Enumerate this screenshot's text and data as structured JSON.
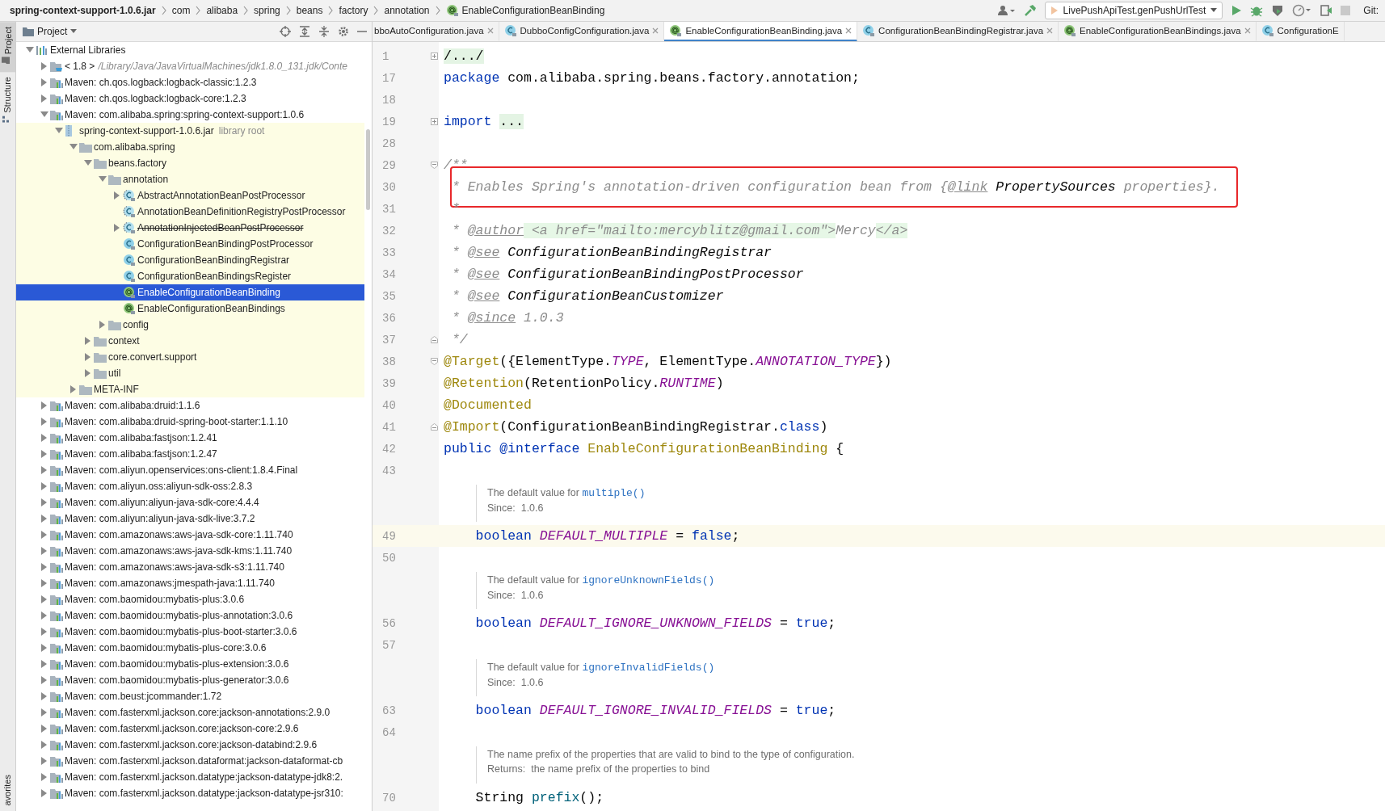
{
  "breadcrumbs": [
    {
      "label": "spring-context-support-1.0.6.jar",
      "kind": "jar"
    },
    {
      "label": "com",
      "kind": "package"
    },
    {
      "label": "alibaba",
      "kind": "package"
    },
    {
      "label": "spring",
      "kind": "package"
    },
    {
      "label": "beans",
      "kind": "package"
    },
    {
      "label": "factory",
      "kind": "package"
    },
    {
      "label": "annotation",
      "kind": "package"
    },
    {
      "label": "EnableConfigurationBeanBinding",
      "kind": "annotation"
    }
  ],
  "toolbar": {
    "run_config": "LivePushApiTest.genPushUrlTest",
    "vcs_label": "Git:"
  },
  "side_tabs": [
    {
      "label": "Project",
      "at_bottom": false,
      "selected": true
    },
    {
      "label": "Structure",
      "at_bottom": false,
      "selected": false
    },
    {
      "label": "avorites",
      "at_bottom": true,
      "selected": false
    }
  ],
  "project_panel": {
    "title": "Project",
    "tree": [
      {
        "label": "External Libraries",
        "kind": "libraries",
        "expanded": true,
        "selected": false,
        "children": [
          {
            "label": "< 1.8 >",
            "detail": "/Library/Java/JavaVirtualMachines/jdk1.8.0_131.jdk/Conte",
            "kind": "jdk",
            "expanded": false,
            "selected": false
          },
          {
            "label": "Maven: ch.qos.logback:logback-classic:1.2.3",
            "kind": "library",
            "expanded": false,
            "selected": false
          },
          {
            "label": "Maven: ch.qos.logback:logback-core:1.2.3",
            "kind": "library",
            "expanded": false,
            "selected": false
          },
          {
            "label": "Maven: com.alibaba.spring:spring-context-support:1.0.6",
            "kind": "library",
            "expanded": true,
            "selected": false,
            "children": [
              {
                "label": "spring-context-support-1.0.6.jar",
                "detail": "library root",
                "kind": "jar",
                "scope": true,
                "expanded": true,
                "selected": false,
                "children": [
                  {
                    "label": "com.alibaba.spring",
                    "kind": "folder",
                    "expanded": true,
                    "selected": false,
                    "children": [
                      {
                        "label": "beans.factory",
                        "kind": "folder",
                        "expanded": true,
                        "selected": false,
                        "children": [
                          {
                            "label": "annotation",
                            "kind": "folder",
                            "expanded": true,
                            "selected": false,
                            "children": [
                              {
                                "label": "AbstractAnnotationBeanPostProcessor",
                                "kind": "abstract-class",
                                "expanded": false,
                                "deprecated": false,
                                "selected": false
                              },
                              {
                                "label": "AnnotationBeanDefinitionRegistryPostProcessor",
                                "kind": "abstract-class",
                                "deprecated": false,
                                "selected": false
                              },
                              {
                                "label": "AnnotationInjectedBeanPostProcessor",
                                "kind": "abstract-class",
                                "expanded": false,
                                "deprecated": true,
                                "selected": false
                              },
                              {
                                "label": "ConfigurationBeanBindingPostProcessor",
                                "kind": "class",
                                "deprecated": false,
                                "selected": false
                              },
                              {
                                "label": "ConfigurationBeanBindingRegistrar",
                                "kind": "class",
                                "deprecated": false,
                                "selected": false
                              },
                              {
                                "label": "ConfigurationBeanBindingsRegister",
                                "kind": "class",
                                "deprecated": false,
                                "selected": false
                              },
                              {
                                "label": "EnableConfigurationBeanBinding",
                                "kind": "annotation",
                                "deprecated": false,
                                "selected": true
                              },
                              {
                                "label": "EnableConfigurationBeanBindings",
                                "kind": "annotation",
                                "deprecated": false,
                                "selected": false
                              }
                            ]
                          },
                          {
                            "label": "config",
                            "kind": "folder",
                            "expanded": false,
                            "selected": false
                          }
                        ]
                      },
                      {
                        "label": "context",
                        "kind": "folder",
                        "expanded": false,
                        "selected": false
                      },
                      {
                        "label": "core.convert.support",
                        "kind": "folder",
                        "expanded": false,
                        "selected": false
                      },
                      {
                        "label": "util",
                        "kind": "folder",
                        "expanded": false,
                        "selected": false
                      }
                    ]
                  },
                  {
                    "label": "META-INF",
                    "kind": "folder",
                    "expanded": false,
                    "selected": false
                  }
                ]
              }
            ]
          },
          {
            "label": "Maven: com.alibaba:druid:1.1.6",
            "kind": "library",
            "expanded": false,
            "selected": false
          },
          {
            "label": "Maven: com.alibaba:druid-spring-boot-starter:1.1.10",
            "kind": "library",
            "expanded": false,
            "selected": false
          },
          {
            "label": "Maven: com.alibaba:fastjson:1.2.41",
            "kind": "library",
            "expanded": false,
            "selected": false
          },
          {
            "label": "Maven: com.alibaba:fastjson:1.2.47",
            "kind": "library",
            "expanded": false,
            "selected": false
          },
          {
            "label": "Maven: com.aliyun.openservices:ons-client:1.8.4.Final",
            "kind": "library",
            "expanded": false,
            "selected": false
          },
          {
            "label": "Maven: com.aliyun.oss:aliyun-sdk-oss:2.8.3",
            "kind": "library",
            "expanded": false,
            "selected": false
          },
          {
            "label": "Maven: com.aliyun:aliyun-java-sdk-core:4.4.4",
            "kind": "library",
            "expanded": false,
            "selected": false
          },
          {
            "label": "Maven: com.aliyun:aliyun-java-sdk-live:3.7.2",
            "kind": "library",
            "expanded": false,
            "selected": false
          },
          {
            "label": "Maven: com.amazonaws:aws-java-sdk-core:1.11.740",
            "kind": "library",
            "expanded": false,
            "selected": false
          },
          {
            "label": "Maven: com.amazonaws:aws-java-sdk-kms:1.11.740",
            "kind": "library",
            "expanded": false,
            "selected": false
          },
          {
            "label": "Maven: com.amazonaws:aws-java-sdk-s3:1.11.740",
            "kind": "library",
            "expanded": false,
            "selected": false
          },
          {
            "label": "Maven: com.amazonaws:jmespath-java:1.11.740",
            "kind": "library",
            "expanded": false,
            "selected": false
          },
          {
            "label": "Maven: com.baomidou:mybatis-plus:3.0.6",
            "kind": "library",
            "expanded": false,
            "selected": false
          },
          {
            "label": "Maven: com.baomidou:mybatis-plus-annotation:3.0.6",
            "kind": "library",
            "expanded": false,
            "selected": false
          },
          {
            "label": "Maven: com.baomidou:mybatis-plus-boot-starter:3.0.6",
            "kind": "library",
            "expanded": false,
            "selected": false
          },
          {
            "label": "Maven: com.baomidou:mybatis-plus-core:3.0.6",
            "kind": "library",
            "expanded": false,
            "selected": false
          },
          {
            "label": "Maven: com.baomidou:mybatis-plus-extension:3.0.6",
            "kind": "library",
            "expanded": false,
            "selected": false
          },
          {
            "label": "Maven: com.baomidou:mybatis-plus-generator:3.0.6",
            "kind": "library",
            "expanded": false,
            "selected": false
          },
          {
            "label": "Maven: com.beust:jcommander:1.72",
            "kind": "library",
            "expanded": false,
            "selected": false
          },
          {
            "label": "Maven: com.fasterxml.jackson.core:jackson-annotations:2.9.0",
            "kind": "library",
            "expanded": false,
            "selected": false
          },
          {
            "label": "Maven: com.fasterxml.jackson.core:jackson-core:2.9.6",
            "kind": "library",
            "expanded": false,
            "selected": false
          },
          {
            "label": "Maven: com.fasterxml.jackson.core:jackson-databind:2.9.6",
            "kind": "library",
            "expanded": false,
            "selected": false
          },
          {
            "label": "Maven: com.fasterxml.jackson.dataformat:jackson-dataformat-cb",
            "kind": "library",
            "expanded": false,
            "selected": false
          },
          {
            "label": "Maven: com.fasterxml.jackson.datatype:jackson-datatype-jdk8:2.",
            "kind": "library",
            "expanded": false,
            "selected": false
          },
          {
            "label": "Maven: com.fasterxml.jackson.datatype:jackson-datatype-jsr310:",
            "kind": "library",
            "expanded": false,
            "selected": false
          }
        ]
      }
    ]
  },
  "editor": {
    "tabs": [
      {
        "label": "bboAutoConfiguration.java",
        "kind": "none",
        "closable": true,
        "selected": false
      },
      {
        "label": "DubboConfigConfiguration.java",
        "kind": "class",
        "closable": true,
        "selected": false
      },
      {
        "label": "EnableConfigurationBeanBinding.java",
        "kind": "annotation",
        "closable": true,
        "selected": true
      },
      {
        "label": "ConfigurationBeanBindingRegistrar.java",
        "kind": "class",
        "closable": true,
        "selected": false
      },
      {
        "label": "EnableConfigurationBeanBindings.java",
        "kind": "annotation",
        "closable": true,
        "selected": false
      },
      {
        "label": "ConfigurationE",
        "kind": "class",
        "closable": false,
        "selected": false
      }
    ],
    "lines": [
      {
        "kind": "code",
        "number": "1",
        "fold": {
          "kind": "collapsed"
        },
        "tokens": [
          {
            "text": "/.../",
            "kind": "folded"
          }
        ]
      },
      {
        "kind": "code",
        "number": "17",
        "tokens": [
          {
            "text": "package",
            "kind": "kw"
          },
          {
            "text": " com.alibaba.spring.beans.factory.annotation;",
            "kind": "plain"
          }
        ]
      },
      {
        "kind": "code",
        "number": "18"
      },
      {
        "kind": "code",
        "number": "19",
        "fold": {
          "kind": "collapsed"
        },
        "tokens": [
          {
            "text": "import ",
            "kind": "kw"
          },
          {
            "text": "...",
            "kind": "folded"
          }
        ]
      },
      {
        "kind": "code",
        "number": "28"
      },
      {
        "kind": "code",
        "number": "29",
        "fold": {
          "kind": "start"
        },
        "tokens": [
          {
            "text": "/**",
            "kind": "comment"
          }
        ]
      },
      {
        "kind": "code",
        "number": "30",
        "boxed": true,
        "tokens": [
          {
            "text": " * Enables Spring's annotation-driven configuration bean from {",
            "kind": "comment"
          },
          {
            "text": "@link",
            "kind": "doctag"
          },
          {
            "text": " PropertySources",
            "kind": "docref"
          },
          {
            "text": " properties}.",
            "kind": "comment"
          }
        ]
      },
      {
        "kind": "code",
        "number": "31",
        "tokens": [
          {
            "text": " *",
            "kind": "comment"
          }
        ]
      },
      {
        "kind": "code",
        "number": "32",
        "tokens": [
          {
            "text": " * ",
            "kind": "comment"
          },
          {
            "text": "@author",
            "kind": "doctag"
          },
          {
            "text": " <a href=\"mailto:mercyblitz@gmail.com\">",
            "kind": "html"
          },
          {
            "text": "Mercy",
            "kind": "comment"
          },
          {
            "text": "</a>",
            "kind": "html"
          }
        ]
      },
      {
        "kind": "code",
        "number": "33",
        "tokens": [
          {
            "text": " * ",
            "kind": "comment"
          },
          {
            "text": "@see",
            "kind": "doctag"
          },
          {
            "text": " ConfigurationBeanBindingRegistrar",
            "kind": "docref"
          }
        ]
      },
      {
        "kind": "code",
        "number": "34",
        "tokens": [
          {
            "text": " * ",
            "kind": "comment"
          },
          {
            "text": "@see",
            "kind": "doctag"
          },
          {
            "text": " ConfigurationBeanBindingPostProcessor",
            "kind": "docref"
          }
        ]
      },
      {
        "kind": "code",
        "number": "35",
        "tokens": [
          {
            "text": " * ",
            "kind": "comment"
          },
          {
            "text": "@see",
            "kind": "doctag"
          },
          {
            "text": " ConfigurationBeanCustomizer",
            "kind": "docref"
          }
        ]
      },
      {
        "kind": "code",
        "number": "36",
        "tokens": [
          {
            "text": " * ",
            "kind": "comment"
          },
          {
            "text": "@since",
            "kind": "doctag"
          },
          {
            "text": " 1.0.3",
            "kind": "comment"
          }
        ]
      },
      {
        "kind": "code",
        "number": "37",
        "fold": {
          "kind": "end"
        },
        "tokens": [
          {
            "text": " */",
            "kind": "comment"
          }
        ]
      },
      {
        "kind": "code",
        "number": "38",
        "fold": {
          "kind": "start"
        },
        "tokens": [
          {
            "text": "@Target",
            "kind": "ann"
          },
          {
            "text": "({ElementType.",
            "kind": "plain"
          },
          {
            "text": "TYPE",
            "kind": "const"
          },
          {
            "text": ", ElementType.",
            "kind": "plain"
          },
          {
            "text": "ANNOTATION_TYPE",
            "kind": "const"
          },
          {
            "text": "})",
            "kind": "plain"
          }
        ]
      },
      {
        "kind": "code",
        "number": "39",
        "tokens": [
          {
            "text": "@Retention",
            "kind": "ann"
          },
          {
            "text": "(RetentionPolicy.",
            "kind": "plain"
          },
          {
            "text": "RUNTIME",
            "kind": "const"
          },
          {
            "text": ")",
            "kind": "plain"
          }
        ]
      },
      {
        "kind": "code",
        "number": "40",
        "tokens": [
          {
            "text": "@Documented",
            "kind": "ann"
          }
        ]
      },
      {
        "kind": "code",
        "number": "41",
        "fold": {
          "kind": "end"
        },
        "tokens": [
          {
            "text": "@Import",
            "kind": "ann"
          },
          {
            "text": "(ConfigurationBeanBindingRegistrar.",
            "kind": "plain"
          },
          {
            "text": "class",
            "kind": "kw"
          },
          {
            "text": ")",
            "kind": "plain"
          }
        ]
      },
      {
        "kind": "code",
        "number": "42",
        "tokens": [
          {
            "text": "public @interface ",
            "kind": "kw"
          },
          {
            "text": "EnableConfigurationBeanBinding",
            "kind": "ann"
          },
          {
            "text": " {",
            "kind": "plain"
          }
        ]
      },
      {
        "kind": "code",
        "number": "43"
      },
      {
        "kind": "doc",
        "rows": [
          [
            {
              "text": "The default value for ",
              "kind": "text"
            },
            {
              "text": "multiple()",
              "kind": "link"
            }
          ],
          [
            {
              "text": "Since:  1.0.6",
              "kind": "text"
            }
          ]
        ]
      },
      {
        "kind": "code",
        "number": "49",
        "current": true,
        "tokens": [
          {
            "text": "    boolean ",
            "kind": "kw"
          },
          {
            "text": "DEFAULT_MULTIPLE",
            "kind": "const"
          },
          {
            "text": " = ",
            "kind": "plain"
          },
          {
            "text": "false",
            "kind": "kw"
          },
          {
            "text": ";",
            "kind": "plain"
          }
        ]
      },
      {
        "kind": "code",
        "number": "50"
      },
      {
        "kind": "doc",
        "rows": [
          [
            {
              "text": "The default value for ",
              "kind": "text"
            },
            {
              "text": "ignoreUnknownFields()",
              "kind": "link"
            }
          ],
          [
            {
              "text": "Since:  1.0.6",
              "kind": "text"
            }
          ]
        ]
      },
      {
        "kind": "code",
        "number": "56",
        "tokens": [
          {
            "text": "    boolean ",
            "kind": "kw"
          },
          {
            "text": "DEFAULT_IGNORE_UNKNOWN_FIELDS",
            "kind": "const"
          },
          {
            "text": " = ",
            "kind": "plain"
          },
          {
            "text": "true",
            "kind": "kw"
          },
          {
            "text": ";",
            "kind": "plain"
          }
        ]
      },
      {
        "kind": "code",
        "number": "57"
      },
      {
        "kind": "doc",
        "rows": [
          [
            {
              "text": "The default value for ",
              "kind": "text"
            },
            {
              "text": "ignoreInvalidFields()",
              "kind": "link"
            }
          ],
          [
            {
              "text": "Since:  1.0.6",
              "kind": "text"
            }
          ]
        ]
      },
      {
        "kind": "code",
        "number": "63",
        "tokens": [
          {
            "text": "    boolean ",
            "kind": "kw"
          },
          {
            "text": "DEFAULT_IGNORE_INVALID_FIELDS",
            "kind": "const"
          },
          {
            "text": " = ",
            "kind": "plain"
          },
          {
            "text": "true",
            "kind": "kw"
          },
          {
            "text": ";",
            "kind": "plain"
          }
        ]
      },
      {
        "kind": "code",
        "number": "64"
      },
      {
        "kind": "doc",
        "rows": [
          [
            {
              "text": "The name prefix of the properties that are valid to bind to the type of configuration.",
              "kind": "text"
            }
          ],
          [
            {
              "text": "Returns:  the name prefix of the properties to bind",
              "kind": "text"
            }
          ]
        ]
      },
      {
        "kind": "code",
        "number": "70",
        "tokens": [
          {
            "text": "    String ",
            "kind": "plain"
          },
          {
            "text": "prefix",
            "kind": "method"
          },
          {
            "text": "();",
            "kind": "plain"
          }
        ]
      }
    ]
  }
}
